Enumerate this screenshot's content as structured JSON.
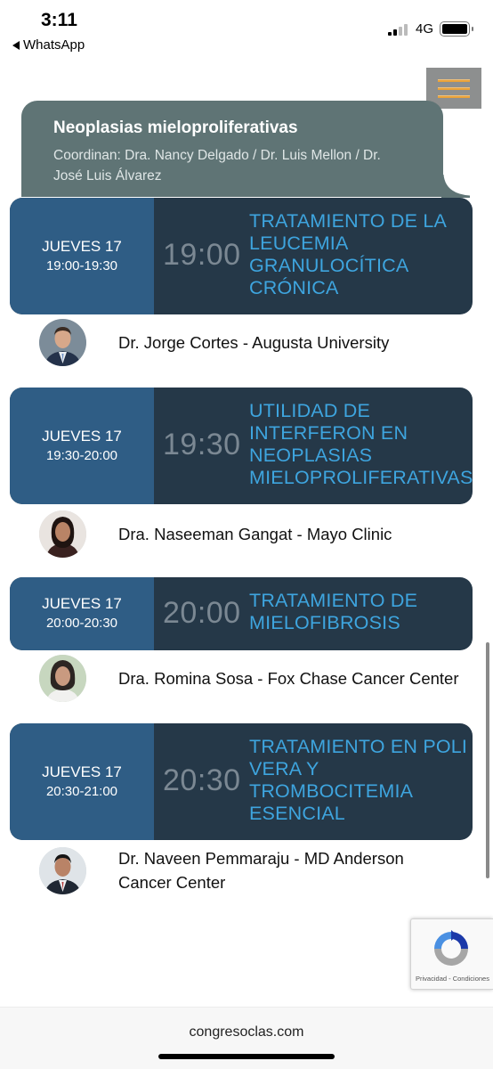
{
  "status_bar": {
    "time": "3:11",
    "back_app": "WhatsApp",
    "network": "4G"
  },
  "header": {
    "title": "Neoplasias mieloproliferativas",
    "coordinators": "Coordinan: Dra. Nancy Delgado / Dr. Luis Mellon / Dr. José Luis Álvarez"
  },
  "sessions": [
    {
      "day": "JUEVES 17",
      "range": "19:00-19:30",
      "hour": "19:00",
      "title": "TRATAMIENTO DE LA LEUCEMIA GRANULOCÍTICA CRÓNICA",
      "speaker": "Dr. Jorge Cortes - Augusta University"
    },
    {
      "day": "JUEVES 17",
      "range": "19:30-20:00",
      "hour": "19:30",
      "title": "UTILIDAD DE INTERFERON EN NEOPLASIAS MIELOPROLIFERATIVAS",
      "speaker": "Dra. Naseeman Gangat - Mayo Clinic"
    },
    {
      "day": "JUEVES 17",
      "range": "20:00-20:30",
      "hour": "20:00",
      "title": "TRATAMIENTO DE MIELOFIBROSIS",
      "speaker": "Dra. Romina Sosa - Fox Chase Cancer Center"
    },
    {
      "day": "JUEVES 17",
      "range": "20:30-21:00",
      "hour": "20:30",
      "title": "TRATAMIENTO EN POLI VERA Y TROMBOCITEMIA ESENCIAL",
      "speaker": "Dr. Naveen Pemmaraju - MD Anderson Cancer Center"
    }
  ],
  "recaptcha": {
    "legal": "Privacidad - Condiciones"
  },
  "browser": {
    "url": "congresoclas.com"
  },
  "colors": {
    "day_block": "#2f5d85",
    "session_bg": "#253848",
    "talk_title": "#3ea5df",
    "header_bg": "#5f7475",
    "menu_lines": "#e8a23a"
  },
  "icons": {
    "menu": "hamburger-icon",
    "back": "back-arrow-icon",
    "recaptcha": "recaptcha-logo-icon"
  }
}
